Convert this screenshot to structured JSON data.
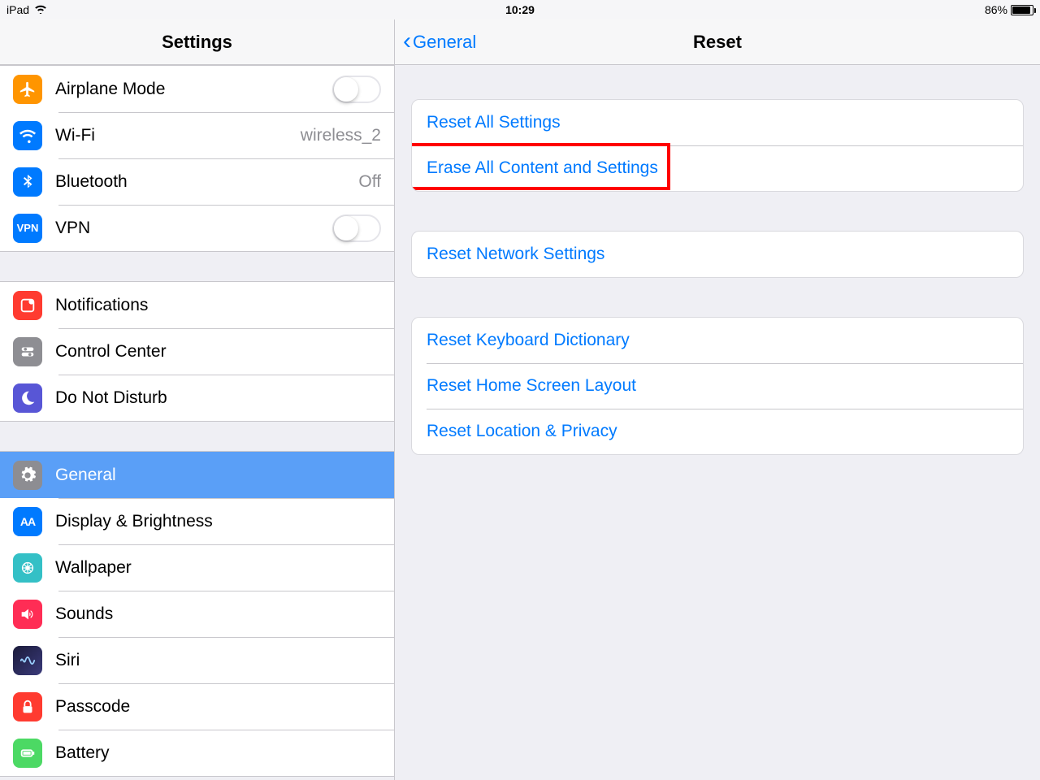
{
  "status": {
    "device": "iPad",
    "time": "10:29",
    "battery_pct": "86%"
  },
  "left": {
    "title": "Settings",
    "groups": [
      [
        {
          "key": "airplane",
          "label": "Airplane Mode",
          "toggle": false
        },
        {
          "key": "wifi",
          "label": "Wi-Fi",
          "value": "wireless_2"
        },
        {
          "key": "bt",
          "label": "Bluetooth",
          "value": "Off"
        },
        {
          "key": "vpn",
          "label": "VPN",
          "toggle": false
        }
      ],
      [
        {
          "key": "notif",
          "label": "Notifications"
        },
        {
          "key": "control",
          "label": "Control Center"
        },
        {
          "key": "dnd",
          "label": "Do Not Disturb"
        }
      ],
      [
        {
          "key": "general",
          "label": "General",
          "selected": true
        },
        {
          "key": "display",
          "label": "Display & Brightness"
        },
        {
          "key": "wallpaper",
          "label": "Wallpaper"
        },
        {
          "key": "sounds",
          "label": "Sounds"
        },
        {
          "key": "siri",
          "label": "Siri"
        },
        {
          "key": "passcode",
          "label": "Passcode"
        },
        {
          "key": "battery",
          "label": "Battery"
        }
      ]
    ]
  },
  "right": {
    "back": "General",
    "title": "Reset",
    "groups": [
      [
        {
          "label": "Reset All Settings"
        },
        {
          "label": "Erase All Content and Settings",
          "highlight": true
        }
      ],
      [
        {
          "label": "Reset Network Settings"
        }
      ],
      [
        {
          "label": "Reset Keyboard Dictionary"
        },
        {
          "label": "Reset Home Screen Layout"
        },
        {
          "label": "Reset Location & Privacy"
        }
      ]
    ]
  }
}
